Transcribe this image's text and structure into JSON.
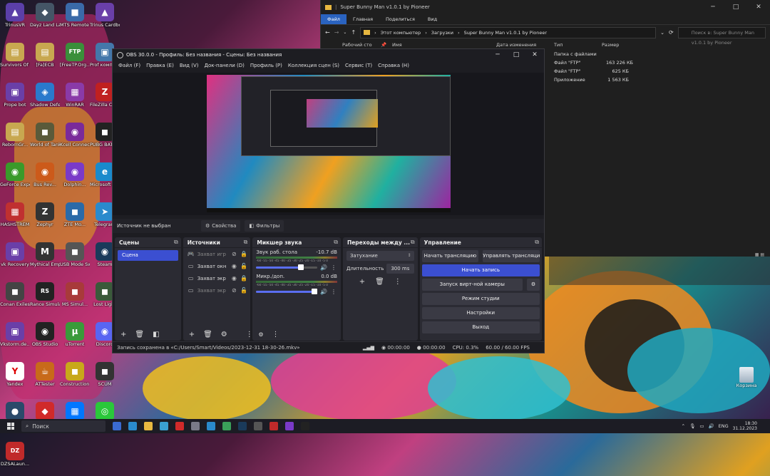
{
  "desktop": {
    "icons": [
      {
        "label": "TrinusVR",
        "color": "#5b3fa8",
        "glyph": "▲"
      },
      {
        "label": "Dayz Land Launcher",
        "color": "#445566",
        "glyph": "◆"
      },
      {
        "label": "MTS Remote play",
        "color": "#3a6aa8",
        "glyph": "■"
      },
      {
        "label": "Trinus Cardboard",
        "color": "#6a3fa8",
        "glyph": "▲"
      },
      {
        "label": "Survivors Of The Dawn",
        "color": "#c8a850",
        "glyph": "▤"
      },
      {
        "label": "[Fa]ECB",
        "color": "#c8a850",
        "glyph": "▤"
      },
      {
        "label": "[FreeTP.Org...",
        "color": "#3a8f3a",
        "glyph": "FTP"
      },
      {
        "label": "Prof компьюте...",
        "color": "#4477aa",
        "glyph": "▣"
      },
      {
        "label": "Prope bot",
        "color": "#6a3fa8",
        "glyph": "▣"
      },
      {
        "label": "Shadow Defender",
        "color": "#2a7acc",
        "glyph": "◈"
      },
      {
        "label": "WinRAR",
        "color": "#8a3aa8",
        "glyph": "▦"
      },
      {
        "label": "FileZilla Client",
        "color": "#c02020",
        "glyph": "Z"
      },
      {
        "label": "RebornGr...",
        "color": "#c8a850",
        "glyph": "▤"
      },
      {
        "label": "World of Tanks Blitz",
        "color": "#5a5a3a",
        "glyph": "◼"
      },
      {
        "label": "Kcell Connect",
        "color": "#7a2a9a",
        "glyph": "◉"
      },
      {
        "label": "PUBG BATTLEGR...",
        "color": "#222",
        "glyph": "◼"
      },
      {
        "label": "GeForce Experience",
        "color": "#3a9a2a",
        "glyph": "◉"
      },
      {
        "label": "Bus Rev...",
        "color": "#cc5a1a",
        "glyph": "◉"
      },
      {
        "label": "Dolphin...",
        "color": "#7a3ac8",
        "glyph": "◉"
      },
      {
        "label": "Microsoft Edge",
        "color": "#1a8acc",
        "glyph": "e"
      },
      {
        "label": "HASHSTREM",
        "color": "#c03030",
        "glyph": "▦"
      },
      {
        "label": "Zephyr",
        "color": "#333",
        "glyph": "Z"
      },
      {
        "label": "ZTE Mo...",
        "color": "#2a6aa8",
        "glyph": "◼"
      },
      {
        "label": "Telegram",
        "color": "#2a8acc",
        "glyph": "➤"
      },
      {
        "label": "vk Recovery",
        "color": "#6a3fa8",
        "glyph": "▣"
      },
      {
        "label": "Mythical Empires",
        "color": "#333",
        "glyph": "M"
      },
      {
        "label": "USB Mode Sw...",
        "color": "#555",
        "glyph": "◼"
      },
      {
        "label": "Steam",
        "color": "#1a3a5a",
        "glyph": "◉"
      },
      {
        "label": "Conan Exiles",
        "color": "#444",
        "glyph": "◼"
      },
      {
        "label": "Rance Simulator",
        "color": "#222",
        "glyph": "RS"
      },
      {
        "label": "MS Simul...",
        "color": "#a83a3a",
        "glyph": "◼"
      },
      {
        "label": "Lost Light",
        "color": "#3a5a3a",
        "glyph": "◼"
      },
      {
        "label": "Vkstorm.de...",
        "color": "#6a3fa8",
        "glyph": "▣"
      },
      {
        "label": "OBS Studio",
        "color": "#222",
        "glyph": "◉"
      },
      {
        "label": "uTorrent",
        "color": "#3a9a3a",
        "glyph": "µ"
      },
      {
        "label": "Discord",
        "color": "#5865f2",
        "glyph": "◉"
      },
      {
        "label": "Yandex",
        "color": "#fff",
        "glyph": "Y"
      },
      {
        "label": "ATTester",
        "color": "#c86a1a",
        "glyph": "☕"
      },
      {
        "label": "Construction Simulator 4",
        "color": "#c8a81a",
        "glyph": "◼"
      },
      {
        "label": "SCUM",
        "color": "#333",
        "glyph": "◼"
      },
      {
        "label": "The Front",
        "color": "#2a4a6a",
        "glyph": "●"
      },
      {
        "label": "AnyDesk",
        "color": "#d02a2a",
        "glyph": "◆"
      },
      {
        "label": "VK Play Игровой...",
        "color": "#0077ff",
        "glyph": "▦"
      },
      {
        "label": "Razer Axon",
        "color": "#2ac83a",
        "glyph": "◎"
      },
      {
        "label": "DZSALaun...",
        "color": "#c02a2a",
        "glyph": "DZ"
      }
    ],
    "recycle_label": "Корзина"
  },
  "explorer": {
    "title": "Super Bunny Man v1.0.1 by Pioneer",
    "ribbon": [
      "Файл",
      "Главная",
      "Поделиться",
      "Вид"
    ],
    "path": [
      "Этот компьютер",
      "Загрузки",
      "Super Bunny Man v1.0.1 by Pioneer"
    ],
    "search_placeholder": "Поиск в: Super Bunny Man v1.0.1 by Pioneer",
    "nav_item": "Рабочий сто",
    "columns": [
      "Имя",
      "Дата изменения",
      "Тип",
      "Размер"
    ],
    "rows": [
      {
        "type": "Папка с файлами",
        "size": ""
      },
      {
        "type": "Файл \"FTP\"",
        "size": "163 226 КБ"
      },
      {
        "type": "Файл \"FTP\"",
        "size": "625 КБ"
      },
      {
        "type": "Приложение",
        "size": "1 563 КБ"
      }
    ]
  },
  "obs": {
    "title": "OBS 30.0.0 - Профиль: Без названия - Сцены: Без названия",
    "menu": [
      "Файл (F)",
      "Правка (E)",
      "Вид (V)",
      "Док-панели (D)",
      "Профиль (P)",
      "Коллекция сцен (S)",
      "Сервис (T)",
      "Справка (H)"
    ],
    "source_bar": {
      "no_source": "Источник не выбран",
      "properties": "Свойства",
      "filters": "Фильтры"
    },
    "scenes": {
      "title": "Сцены",
      "items": [
        "Сцена"
      ]
    },
    "sources": {
      "title": "Источники",
      "items": [
        "Захват игр",
        "Захват окн",
        "Захват экр",
        "Захват экр"
      ]
    },
    "mixer": {
      "title": "Микшер звука",
      "scale": "-60 -55 -50 -45 -40 -35 -30 -25 -20 -15 -10 -5 0",
      "channels": [
        {
          "name": "Звук раб. стола",
          "db": "-10.7 dB",
          "level": 0.78
        },
        {
          "name": "Микр./доп.",
          "db": "0.0 dB",
          "level": 1.0
        }
      ]
    },
    "transitions": {
      "title": "Переходы между ...",
      "selected": "Затухание",
      "duration_label": "Длительность",
      "duration_value": "300 ms"
    },
    "controls": {
      "title": "Управление",
      "start_stream": "Начать трансляцию",
      "manage_stream": "Управлять трансляцией",
      "start_record": "Начать запись",
      "virtual_cam": "Запуск вирт-ной камеры",
      "studio_mode": "Режим студии",
      "settings": "Настройки",
      "exit": "Выход"
    },
    "status": {
      "message": "Запись сохранена в «C:/Users/Smart/Videos/2023-12-31 18-30-26.mkv»",
      "stream_time": "00:00:00",
      "rec_time": "00:00:00",
      "cpu": "CPU: 0.3%",
      "fps": "60.00 / 60.00 FPS"
    }
  },
  "taskbar": {
    "search": "Поиск",
    "lang": "ENG",
    "time": "18:30",
    "date": "31.12.2023"
  },
  "colors": {
    "accent": "#3b4fd1",
    "explorer_active": "#2a63c0"
  }
}
